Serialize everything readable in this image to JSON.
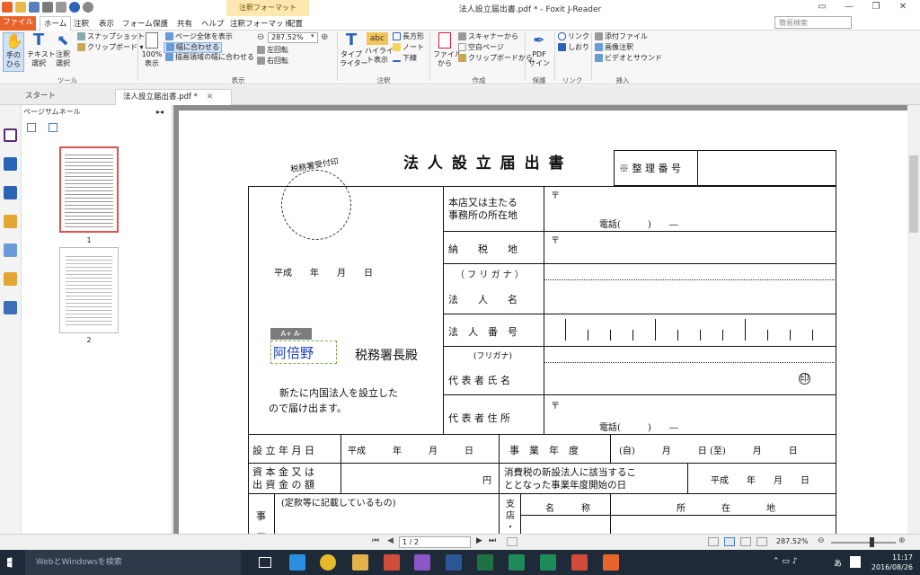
{
  "window": {
    "title": "法人設立届出書.pdf * - Foxit J-Reader",
    "context_tab": "注釈フォーマット"
  },
  "menu": {
    "items": [
      "ファイル",
      "ホーム",
      "注釈",
      "表示",
      "フォーム",
      "保護",
      "共有",
      "ヘルプ",
      "注釈フォーマット",
      "配置"
    ],
    "search_placeholder": "簡易検索"
  },
  "ribbon": {
    "tools": {
      "hand": "手の\nひら",
      "text_select": "テキスト\n選択",
      "annot_select": "注釈\n選択",
      "snapshot": "スナップショット",
      "clipboard": "クリップボード ▾",
      "group": "ツール"
    },
    "view": {
      "actual": "100%\n表示",
      "fit_page": "ページ全体を表示",
      "fit_width": "幅に合わせる",
      "fit_visible": "描画領域の幅に合わせる",
      "zoom": "287.52%",
      "rot_left": "左回転",
      "rot_right": "右回転",
      "group": "表示"
    },
    "annot": {
      "typewriter": "タイプ\nライター",
      "highlight": "ハイライ\nト表示",
      "rect": "長方形",
      "note": "ノート",
      "underline": "下線",
      "abc": "abc",
      "group": "注釈"
    },
    "create": {
      "from_file": "ファイル\nから",
      "scanner": "スキャナーから",
      "blank": "空白ページ",
      "from_clip": "クリップボードから",
      "group": "作成"
    },
    "protect": {
      "pdf_sign": "PDF\nサイン",
      "group": "保護"
    },
    "link": {
      "link": "リンク",
      "bookmark": "しおり",
      "group": "リンク"
    },
    "insert": {
      "attach": "添付ファイル",
      "image": "画像注釈",
      "video": "ビデオとサウンド",
      "group": "挿入"
    }
  },
  "tabs": {
    "start": "スタート",
    "doc": "法人設立届出書.pdf *"
  },
  "thumbs": {
    "header": "ページサムネール",
    "p1": "1",
    "p2": "2"
  },
  "form": {
    "title": "法 人 設 立 届 出 書",
    "stamp": "税務署受付印",
    "seiri": "※ 整 理 番 号",
    "heisei_date": "平成　　年　　月　　日",
    "typed_name": "阿倍野",
    "font_tools": "A+  A-",
    "zeimusho": "税務署長殿",
    "body1": "新たに内国法人を設立した",
    "body2": "ので届け出ます。",
    "addr_label": "本店又は主たる\n事務所の所在地",
    "postal": "〒",
    "tel": "電話(　　　)　　―",
    "nozeichi": "納　　税　　地",
    "furigana": "（ フ リ ガ ナ ）",
    "hojinmei": "法　　人　　名",
    "hojinbango": "法　人　番　号",
    "furigana2": "(フリガナ)",
    "daihyo": "代 表 者 氏 名",
    "daihyo_addr": "代 表 者 住 所",
    "seal": "印",
    "setsuritsu": "設 立 年 月 日",
    "setsuritsu_val": "平成　　　年　　　月　　　日",
    "jigyo_nendo": "事　業　年　度",
    "nendo_val": "(自)　　　月　　　日 (至)　　　月　　　日",
    "shihon": "資 本 金 又 は\n出 資 金 の 額",
    "yen": "円",
    "shohizei": "消費税の新設法人に該当するこ\nととなった事業年度開始の日",
    "shohizei_val": "平成　　年　　月　　日",
    "jigyo": "事\n業",
    "jigyo_val": "(定款等に記載しているもの)",
    "shiten": "支\n店\n・",
    "meisho": "名　　　称",
    "shozaichi": "所　　　　在　　　　地"
  },
  "status": {
    "page": "1 / 2",
    "zoom": "287.52%"
  },
  "taskbar": {
    "search": "WebとWindowsを検索",
    "time": "11:17",
    "date": "2016/08/26",
    "ime": "あ"
  }
}
